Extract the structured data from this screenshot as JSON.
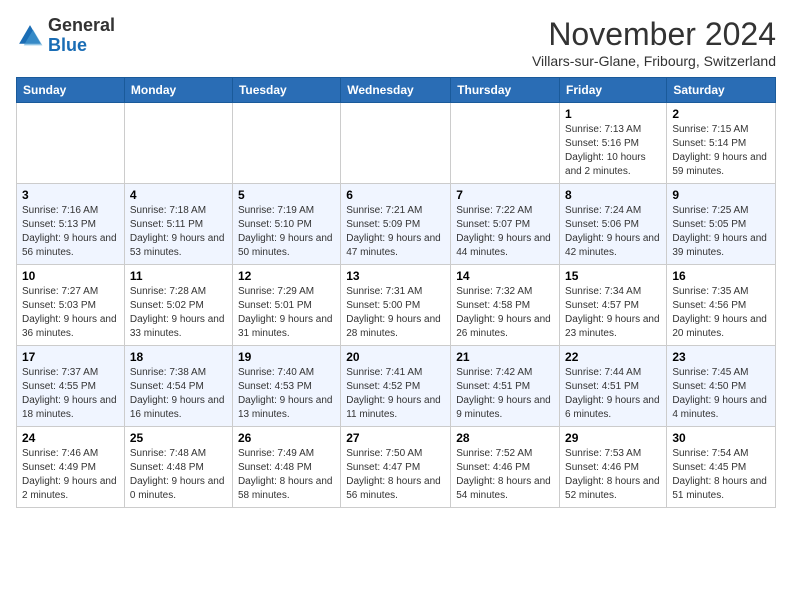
{
  "logo": {
    "general": "General",
    "blue": "Blue"
  },
  "title": "November 2024",
  "location": "Villars-sur-Glane, Fribourg, Switzerland",
  "days_of_week": [
    "Sunday",
    "Monday",
    "Tuesday",
    "Wednesday",
    "Thursday",
    "Friday",
    "Saturday"
  ],
  "weeks": [
    [
      {
        "day": "",
        "info": ""
      },
      {
        "day": "",
        "info": ""
      },
      {
        "day": "",
        "info": ""
      },
      {
        "day": "",
        "info": ""
      },
      {
        "day": "",
        "info": ""
      },
      {
        "day": "1",
        "info": "Sunrise: 7:13 AM\nSunset: 5:16 PM\nDaylight: 10 hours and 2 minutes."
      },
      {
        "day": "2",
        "info": "Sunrise: 7:15 AM\nSunset: 5:14 PM\nDaylight: 9 hours and 59 minutes."
      }
    ],
    [
      {
        "day": "3",
        "info": "Sunrise: 7:16 AM\nSunset: 5:13 PM\nDaylight: 9 hours and 56 minutes."
      },
      {
        "day": "4",
        "info": "Sunrise: 7:18 AM\nSunset: 5:11 PM\nDaylight: 9 hours and 53 minutes."
      },
      {
        "day": "5",
        "info": "Sunrise: 7:19 AM\nSunset: 5:10 PM\nDaylight: 9 hours and 50 minutes."
      },
      {
        "day": "6",
        "info": "Sunrise: 7:21 AM\nSunset: 5:09 PM\nDaylight: 9 hours and 47 minutes."
      },
      {
        "day": "7",
        "info": "Sunrise: 7:22 AM\nSunset: 5:07 PM\nDaylight: 9 hours and 44 minutes."
      },
      {
        "day": "8",
        "info": "Sunrise: 7:24 AM\nSunset: 5:06 PM\nDaylight: 9 hours and 42 minutes."
      },
      {
        "day": "9",
        "info": "Sunrise: 7:25 AM\nSunset: 5:05 PM\nDaylight: 9 hours and 39 minutes."
      }
    ],
    [
      {
        "day": "10",
        "info": "Sunrise: 7:27 AM\nSunset: 5:03 PM\nDaylight: 9 hours and 36 minutes."
      },
      {
        "day": "11",
        "info": "Sunrise: 7:28 AM\nSunset: 5:02 PM\nDaylight: 9 hours and 33 minutes."
      },
      {
        "day": "12",
        "info": "Sunrise: 7:29 AM\nSunset: 5:01 PM\nDaylight: 9 hours and 31 minutes."
      },
      {
        "day": "13",
        "info": "Sunrise: 7:31 AM\nSunset: 5:00 PM\nDaylight: 9 hours and 28 minutes."
      },
      {
        "day": "14",
        "info": "Sunrise: 7:32 AM\nSunset: 4:58 PM\nDaylight: 9 hours and 26 minutes."
      },
      {
        "day": "15",
        "info": "Sunrise: 7:34 AM\nSunset: 4:57 PM\nDaylight: 9 hours and 23 minutes."
      },
      {
        "day": "16",
        "info": "Sunrise: 7:35 AM\nSunset: 4:56 PM\nDaylight: 9 hours and 20 minutes."
      }
    ],
    [
      {
        "day": "17",
        "info": "Sunrise: 7:37 AM\nSunset: 4:55 PM\nDaylight: 9 hours and 18 minutes."
      },
      {
        "day": "18",
        "info": "Sunrise: 7:38 AM\nSunset: 4:54 PM\nDaylight: 9 hours and 16 minutes."
      },
      {
        "day": "19",
        "info": "Sunrise: 7:40 AM\nSunset: 4:53 PM\nDaylight: 9 hours and 13 minutes."
      },
      {
        "day": "20",
        "info": "Sunrise: 7:41 AM\nSunset: 4:52 PM\nDaylight: 9 hours and 11 minutes."
      },
      {
        "day": "21",
        "info": "Sunrise: 7:42 AM\nSunset: 4:51 PM\nDaylight: 9 hours and 9 minutes."
      },
      {
        "day": "22",
        "info": "Sunrise: 7:44 AM\nSunset: 4:51 PM\nDaylight: 9 hours and 6 minutes."
      },
      {
        "day": "23",
        "info": "Sunrise: 7:45 AM\nSunset: 4:50 PM\nDaylight: 9 hours and 4 minutes."
      }
    ],
    [
      {
        "day": "24",
        "info": "Sunrise: 7:46 AM\nSunset: 4:49 PM\nDaylight: 9 hours and 2 minutes."
      },
      {
        "day": "25",
        "info": "Sunrise: 7:48 AM\nSunset: 4:48 PM\nDaylight: 9 hours and 0 minutes."
      },
      {
        "day": "26",
        "info": "Sunrise: 7:49 AM\nSunset: 4:48 PM\nDaylight: 8 hours and 58 minutes."
      },
      {
        "day": "27",
        "info": "Sunrise: 7:50 AM\nSunset: 4:47 PM\nDaylight: 8 hours and 56 minutes."
      },
      {
        "day": "28",
        "info": "Sunrise: 7:52 AM\nSunset: 4:46 PM\nDaylight: 8 hours and 54 minutes."
      },
      {
        "day": "29",
        "info": "Sunrise: 7:53 AM\nSunset: 4:46 PM\nDaylight: 8 hours and 52 minutes."
      },
      {
        "day": "30",
        "info": "Sunrise: 7:54 AM\nSunset: 4:45 PM\nDaylight: 8 hours and 51 minutes."
      }
    ]
  ]
}
